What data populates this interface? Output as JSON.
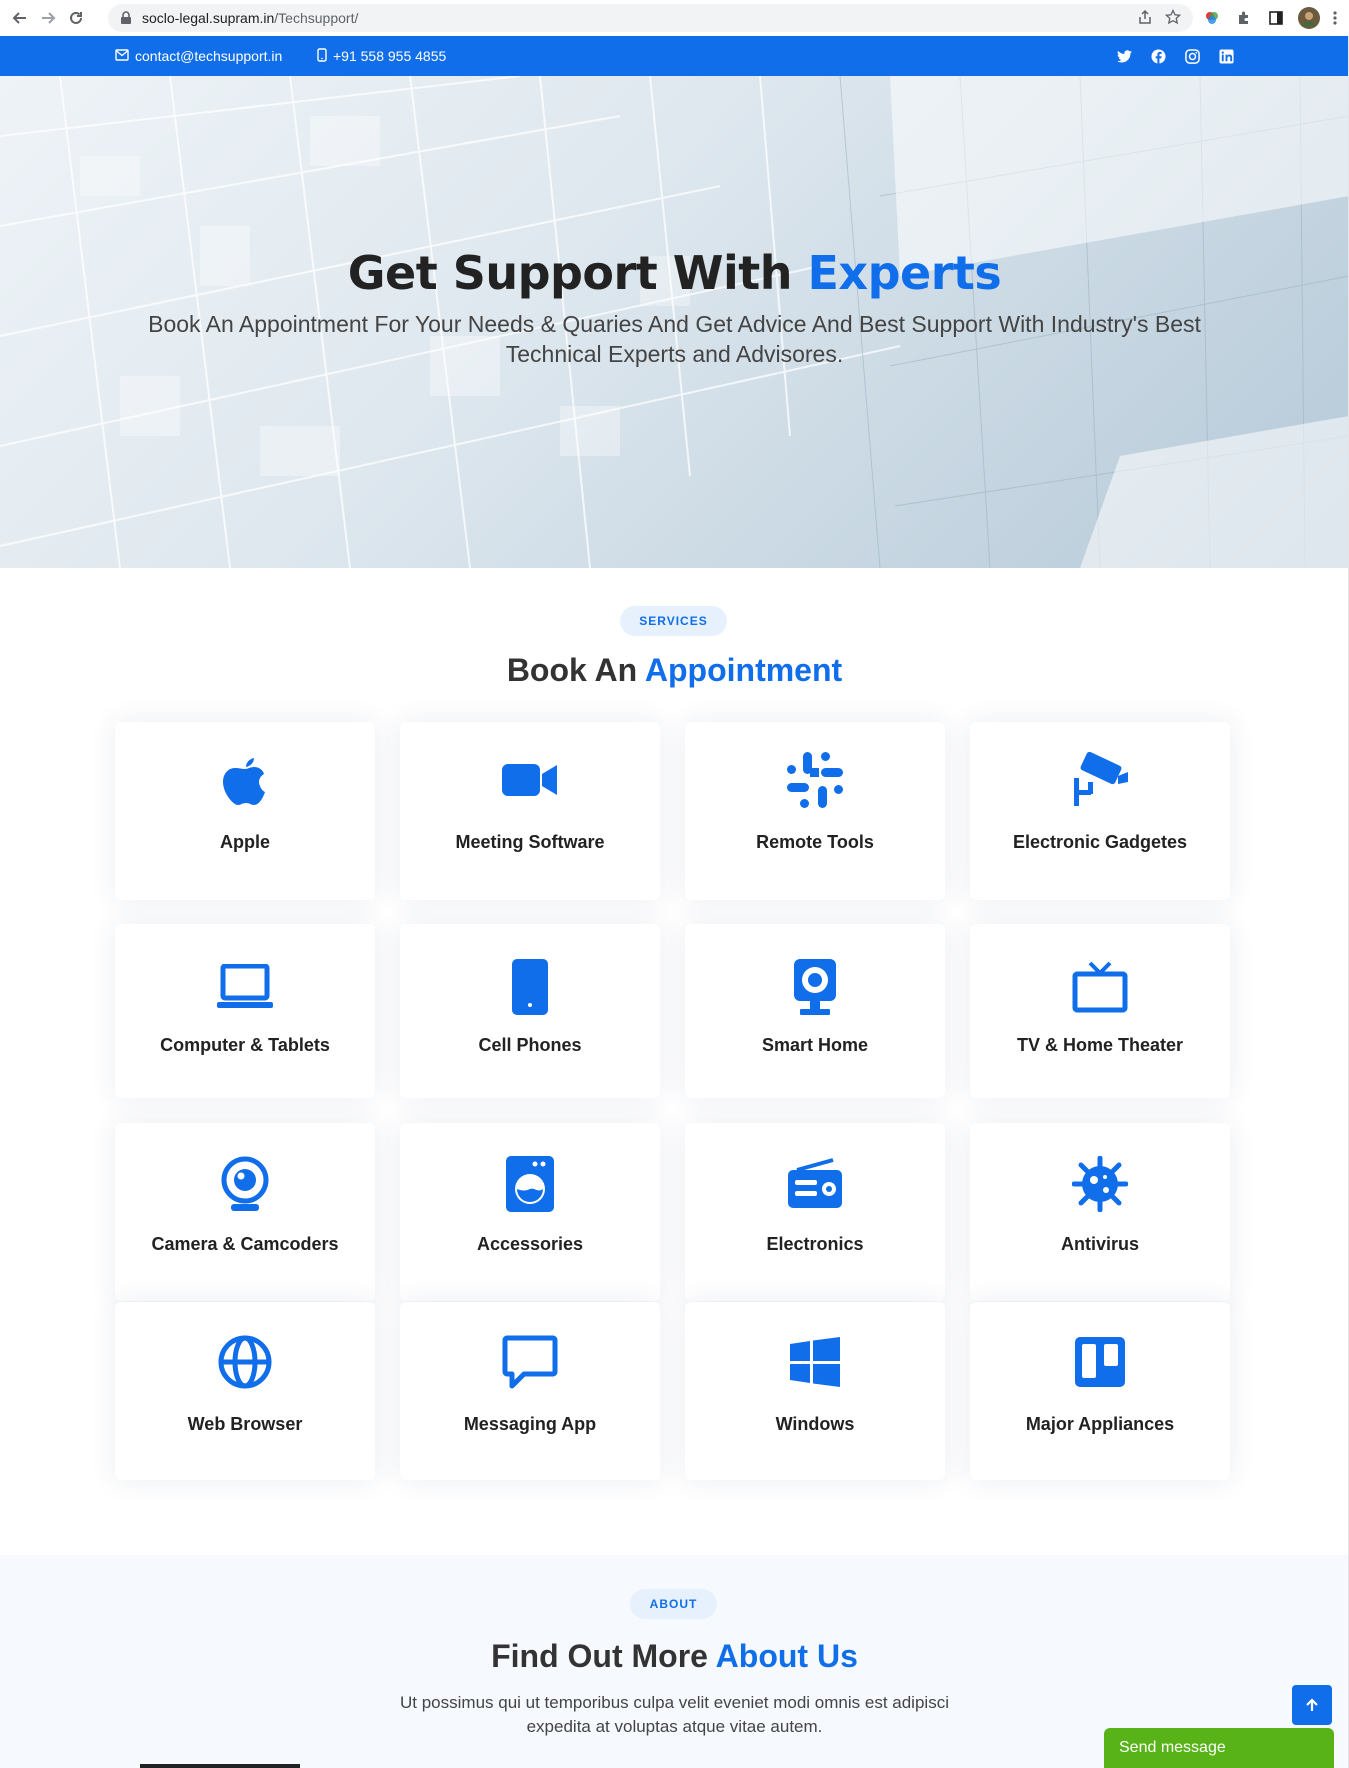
{
  "browser": {
    "url_host": "soclo-legal.supram.in",
    "url_path": "/Techsupport/"
  },
  "topbar": {
    "email": "contact@techsupport.in",
    "phone": "+91 558 955 4855",
    "social": [
      "twitter-icon",
      "facebook-icon",
      "instagram-icon",
      "linkedin-icon"
    ]
  },
  "hero": {
    "title_main": "Get Support With ",
    "title_highlight": "Experts",
    "subtitle": "Book An Appointment For Your Needs & Quaries And Get Advice And Best Support With Industry's Best Technical Experts and Advisores."
  },
  "services": {
    "badge": "SERVICES",
    "title_main": "Book An ",
    "title_highlight": "Appointment",
    "items": [
      {
        "label": "Apple",
        "icon": "apple-icon"
      },
      {
        "label": "Meeting Software",
        "icon": "video-camera-icon"
      },
      {
        "label": "Remote Tools",
        "icon": "slack-icon"
      },
      {
        "label": "Electronic Gadgetes",
        "icon": "security-camera-icon"
      },
      {
        "label": "Computer & Tablets",
        "icon": "laptop-icon"
      },
      {
        "label": "Cell Phones",
        "icon": "phone-icon"
      },
      {
        "label": "Smart Home",
        "icon": "speaker-icon"
      },
      {
        "label": "TV & Home Theater",
        "icon": "tv-icon"
      },
      {
        "label": "Camera & Camcoders",
        "icon": "webcam-icon"
      },
      {
        "label": "Accessories",
        "icon": "washing-machine-icon"
      },
      {
        "label": "Electronics",
        "icon": "radio-icon"
      },
      {
        "label": "Antivirus",
        "icon": "virus-icon"
      },
      {
        "label": "Web Browser",
        "icon": "globe-icon"
      },
      {
        "label": "Messaging App",
        "icon": "chat-icon"
      },
      {
        "label": "Windows",
        "icon": "windows-icon"
      },
      {
        "label": "Major Appliances",
        "icon": "trello-icon"
      }
    ]
  },
  "about": {
    "badge": "ABOUT",
    "title_main": "Find Out More ",
    "title_highlight": "About Us",
    "text": "Ut possimus qui ut temporibus culpa velit eveniet modi omnis est adipisci expedita at voluptas atque vitae autem."
  },
  "widgets": {
    "send_message": "Send message"
  },
  "colors": {
    "accent": "#106eea",
    "send_button": "#57b317"
  }
}
